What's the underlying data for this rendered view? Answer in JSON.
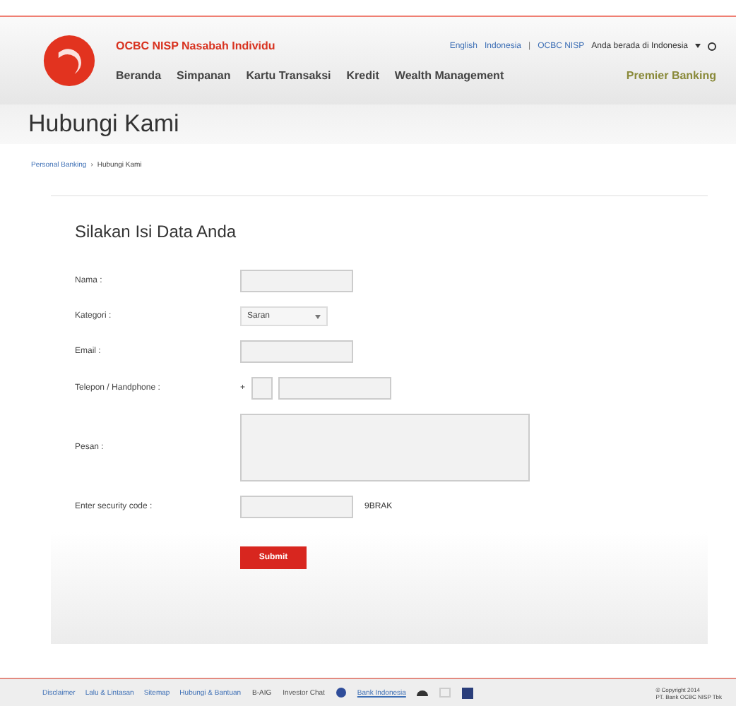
{
  "header": {
    "brand": "OCBC NISP Nasabah Individu",
    "links": [
      "English",
      "Indonesia",
      "|",
      "OCBC NISP"
    ],
    "location": "Anda berada di Indonesia",
    "nav": [
      {
        "label": "Beranda",
        "selected": false
      },
      {
        "label": "Simpanan",
        "selected": false
      },
      {
        "label": "Kartu Transaksi",
        "selected": false
      },
      {
        "label": "Kredit",
        "selected": false
      },
      {
        "label": "Wealth Management",
        "selected": false
      }
    ],
    "premier": "Premier Banking"
  },
  "page_title": "Hubungi Kami",
  "breadcrumb": [
    "Personal Banking",
    "›",
    "Hubungi Kami"
  ],
  "form": {
    "title": "Silakan Isi Data Anda",
    "fields": [
      {
        "kind": "text",
        "label": "Nama :"
      },
      {
        "kind": "select",
        "label": "Kategori :",
        "value": "Saran"
      },
      {
        "kind": "text",
        "label": "Email :"
      },
      {
        "kind": "phone",
        "label": "Telepon / Handphone :",
        "prefix": "+"
      },
      {
        "kind": "textarea",
        "label": "Pesan :"
      },
      {
        "kind": "captcha",
        "label": "Enter security code :",
        "code": "9BRAK"
      }
    ],
    "submit": "Submit"
  },
  "footer": {
    "links": [
      "Disclaimer",
      "Lalu & Lintasan",
      "Sitemap",
      "Hubungi & Bantuan"
    ],
    "badge": "B-AIG",
    "chat": "Investor Chat",
    "bank_link": "Bank Indonesia",
    "copyright": [
      "© Copyright 2014",
      "PT. Bank OCBC NISP Tbk"
    ]
  }
}
